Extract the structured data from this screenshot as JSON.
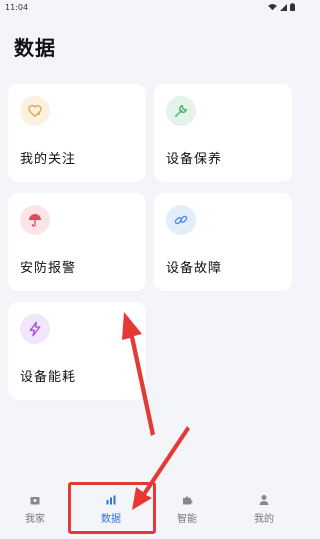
{
  "status_bar": {
    "time": "11:04"
  },
  "page": {
    "title": "数据"
  },
  "cards": {
    "follow": {
      "label": "我的关注",
      "icon": "heart-icon",
      "icon_bg": "#fbf1e1",
      "icon_color": "#e3a44a"
    },
    "maint": {
      "label": "设备保养",
      "icon": "wrench-icon",
      "icon_bg": "#e4f4ea",
      "icon_color": "#47b36a"
    },
    "security": {
      "label": "安防报警",
      "icon": "umbrella-icon",
      "icon_bg": "#fbe5e8",
      "icon_color": "#e04a5a"
    },
    "fault": {
      "label": "设备故障",
      "icon": "link-icon",
      "icon_bg": "#e4eefb",
      "icon_color": "#4b8ae0"
    },
    "energy": {
      "label": "设备能耗",
      "icon": "lightning-icon",
      "icon_bg": "#f1e6fb",
      "icon_color": "#b04ae0"
    }
  },
  "bottom_nav": {
    "items": [
      {
        "label": "我家",
        "icon": "home-icon"
      },
      {
        "label": "数据",
        "icon": "bar-chart-icon",
        "active": true
      },
      {
        "label": "智能",
        "icon": "puzzle-icon"
      },
      {
        "label": "我的",
        "icon": "person-icon"
      }
    ]
  },
  "colors": {
    "background": "#f3f5f9",
    "card": "#ffffff",
    "accent": "#2f6fe0",
    "annotation_red": "#e53935"
  }
}
